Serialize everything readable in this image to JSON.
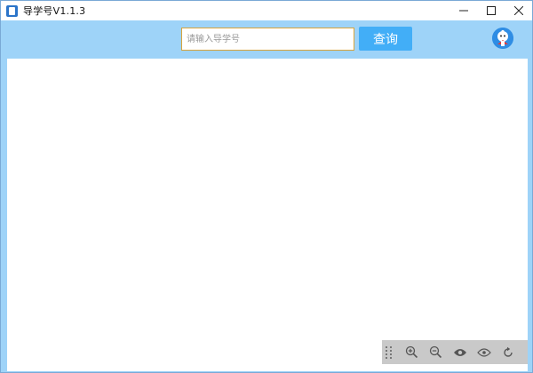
{
  "window": {
    "title": "导学号V1.1.3",
    "controls": {
      "minimize_icon": "minimize-icon",
      "maximize_icon": "maximize-icon",
      "close_icon": "close-icon"
    }
  },
  "search": {
    "placeholder": "请输入导学号",
    "value": "",
    "button_label": "查询"
  },
  "viewer_toolbar": {
    "tools": [
      {
        "icon": "drag-handle-icon"
      },
      {
        "icon": "zoom-in-icon"
      },
      {
        "icon": "zoom-out-icon"
      },
      {
        "icon": "eye-icon"
      },
      {
        "icon": "eye-outline-icon"
      },
      {
        "icon": "rotate-icon"
      }
    ]
  },
  "colors": {
    "background": "#9ed3f8",
    "accent": "#42aef7",
    "input_border": "#d7a33b",
    "toolbar": "#c9c9c9"
  }
}
